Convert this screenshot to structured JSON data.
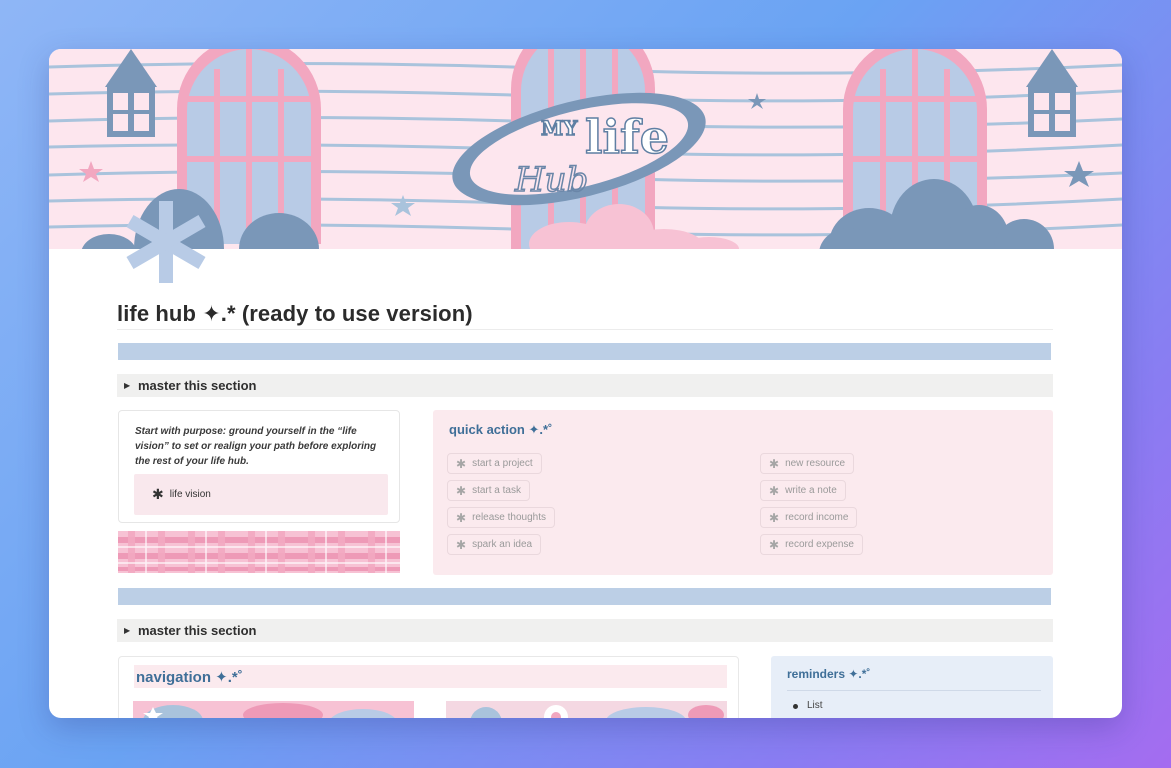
{
  "cover": {
    "logo_small": "MY",
    "logo_big": "life",
    "logo_script": "Hub"
  },
  "page": {
    "title": "life hub ✦.* (ready to use version)"
  },
  "sections": [
    {
      "toggle_label": "master this section"
    },
    {
      "toggle_label": "master this section"
    }
  ],
  "vision": {
    "prompt": "Start with purpose: ground yourself in the “life vision” to set or realign your path before exploring the rest of your life hub.",
    "link_label": "life vision"
  },
  "quick_action": {
    "title": "quick action ✦.*˚",
    "left_buttons": [
      "start a project",
      "start a task",
      "release thoughts",
      "spark an idea"
    ],
    "right_buttons": [
      "new resource",
      "write a note",
      "record income",
      "record expense"
    ]
  },
  "navigation": {
    "title": "navigation ✦.*˚"
  },
  "reminders": {
    "title": "reminders ✦.*˚",
    "items": [
      "List"
    ]
  },
  "colors": {
    "accent_blue": "#3f6f98",
    "divider_blue": "#bccfe6",
    "panel_pink": "#fbeaee",
    "cover_pink": "#fde6ee",
    "slate": "#7a97b8"
  }
}
